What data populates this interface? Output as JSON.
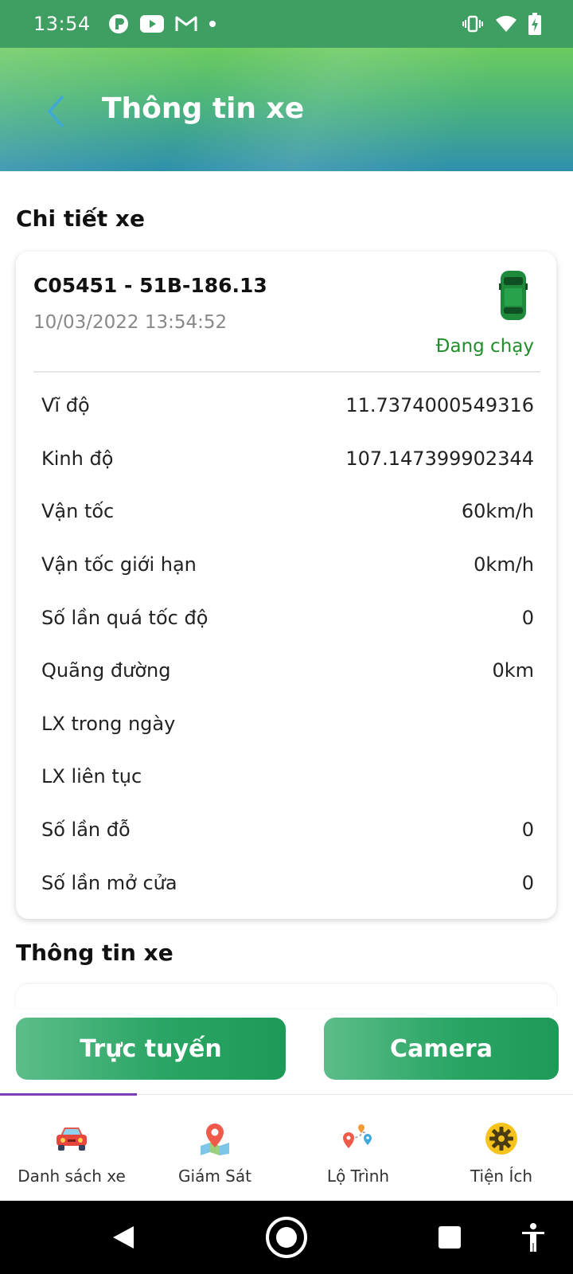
{
  "status_bar": {
    "time": "13:54"
  },
  "header": {
    "title": "Thông tin xe"
  },
  "details": {
    "section_title": "Chi tiết xe",
    "vehicle_id": "C05451 - 51B-186.13",
    "timestamp": "10/03/2022 13:54:52",
    "status": "Đang chạy",
    "rows": [
      {
        "label": "Vĩ độ",
        "value": "11.7374000549316"
      },
      {
        "label": "Kinh độ",
        "value": "107.147399902344"
      },
      {
        "label": "Vận tốc",
        "value": "60km/h"
      },
      {
        "label": "Vận tốc giới hạn",
        "value": "0km/h"
      },
      {
        "label": "Số lần quá tốc độ",
        "value": "0"
      },
      {
        "label": "Quãng đường",
        "value": "0km"
      },
      {
        "label": "LX trong ngày",
        "value": ""
      },
      {
        "label": "LX liên tục",
        "value": ""
      },
      {
        "label": "Số lần đỗ",
        "value": "0"
      },
      {
        "label": "Số lần mở cửa",
        "value": "0"
      }
    ]
  },
  "info_section_title": "Thông tin xe",
  "actions": {
    "online_label": "Trực tuyến",
    "camera_label": "Camera"
  },
  "bottom_nav": [
    {
      "label": "Danh sách xe",
      "icon": "car-icon"
    },
    {
      "label": "Giám Sát",
      "icon": "map-pin-icon"
    },
    {
      "label": "Lộ Trình",
      "icon": "route-icon"
    },
    {
      "label": "Tiện Ích",
      "icon": "gear-icon"
    }
  ],
  "colors": {
    "accent": "#2aa564",
    "status_running": "#1f8e2b",
    "nav_indicator": "#7b3fb5"
  }
}
